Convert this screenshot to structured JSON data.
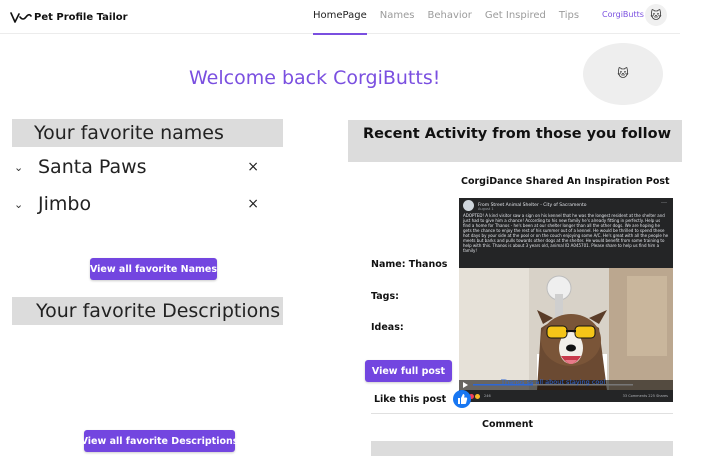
{
  "brand": {
    "name": "Pet Profile Tailor",
    "accent": "#7a4fe0"
  },
  "nav": {
    "links": [
      "HomePage",
      "Names",
      "Behavior",
      "Get Inspired",
      "Tips"
    ],
    "active": "HomePage",
    "user": "CorgiButts",
    "avatar_icon": "🐱"
  },
  "welcome": {
    "text": "Welcome back CorgiButts!",
    "bubble_icon": "🐱"
  },
  "favorites": {
    "names_heading": "Your favorite names",
    "names": [
      "Santa Paws",
      "Jimbo"
    ],
    "expand_icon": "chevron-down-icon",
    "remove_icon": "close-icon",
    "close_glyph": "×",
    "chevron_glyph": "⌄",
    "view_names_button": "View all favorite Names",
    "descriptions_heading": "Your favorite Descriptions",
    "view_descriptions_button": "View all favorite Descriptions"
  },
  "activity": {
    "heading": "Recent Activity from those you follow",
    "post": {
      "title": "CorgiDance Shared An Inspiration Post",
      "name_label": "Name: Thanos",
      "tags_label": "Tags:",
      "ideas_label": "Ideas:",
      "view_button": "View full post",
      "like_label": "Like this post",
      "comment_label": "Comment",
      "shot": {
        "org": "From Street Animal Shelter - City of Sacramento",
        "date": "August 1",
        "caption": "ADOPTED! A kind visitor saw a sign on his kennel that he was the longest resident at the shelter and just had to give him a chance! According to his new family he's already fitting in perfectly. Help us find a home for Thanos - he's been at our shelter longer than all the other dogs. We are hoping he gets the chance to enjoy the rest of his summer out of a kennel. He would be thrilled to spend these hot days by your side at the pool or on the couch enjoying some A/C. He's great with all the people he meets but barks and pulls towards other dogs at the shelter. He would benefit from some training to help with this. Thanos is about 3 years old, animal ID A045701. Please share to help us find him a family!",
        "subtitle": "Thanos ss all about staying cool",
        "reaction_count": "246",
        "stats": "33 Comments 225 Shares"
      }
    }
  }
}
